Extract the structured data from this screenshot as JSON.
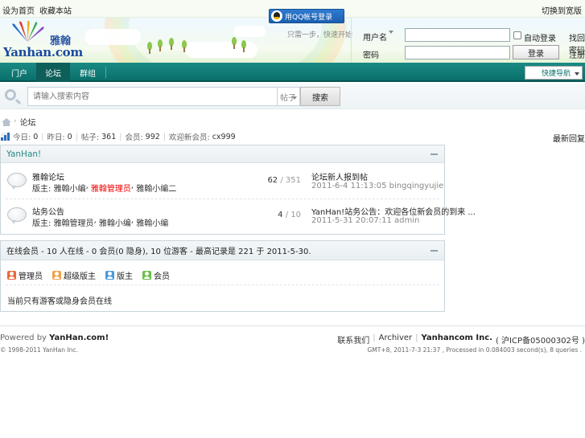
{
  "toplinks": {
    "left": [
      "设为首页",
      "收藏本站"
    ],
    "right": "切换到宽版"
  },
  "header": {
    "logo_text": "Yanhan.com",
    "logo_cn": "雅翰",
    "qq_login": "用QQ帐号登录",
    "qq_sub": "只需一步，快速开始",
    "username_label": "用户名",
    "password_label": "密码",
    "remember_label": "自动登录",
    "forgot_label": "找回密码",
    "login_button": "登录",
    "register_label": "注册"
  },
  "nav": {
    "items": [
      "门户",
      "论坛",
      "群组"
    ],
    "active_index": 1,
    "quick": "快捷导航"
  },
  "search": {
    "placeholder": "请输入搜索内容",
    "type": "帖子",
    "button": "搜索"
  },
  "breadcrumb": {
    "arrow": "›",
    "current": "论坛"
  },
  "stats": {
    "items": [
      {
        "label": "今日:",
        "value": "0"
      },
      {
        "label": "昨日:",
        "value": "0"
      },
      {
        "label": "帖子:",
        "value": "361"
      },
      {
        "label": "会员:",
        "value": "992"
      },
      {
        "label": "欢迎新会员:",
        "value": "cx999"
      }
    ],
    "right": "最新回复"
  },
  "category": {
    "title": "YanHan!",
    "forums": [
      {
        "name": "雅翰论坛",
        "mod_label": "版主:",
        "mods": [
          "雅翰小编",
          "雅翰管理员",
          "雅翰小编二"
        ],
        "threads": "62",
        "posts": "/ 351",
        "last_title": "论坛新人报到帖",
        "last_meta": "2011-6-4 11:13:05 bingqingyujie"
      },
      {
        "name": "站务公告",
        "mod_label": "版主:",
        "mods": [
          "雅翰管理员",
          "雅翰小编",
          "雅翰小编"
        ],
        "threads": "4",
        "posts": "/ 10",
        "last_title": "YanHan!站务公告：欢迎各位新会员的到来 ...",
        "last_meta": "2011-5-31 20:07:11 admin"
      }
    ]
  },
  "online": {
    "title": "在线会员 - 10 人在线 - 0 会员(0 隐身), 10 位游客 - 最高记录是 221 于 2011-5-30.",
    "legend": [
      "管理员",
      "超级版主",
      "版主",
      "会员"
    ],
    "legend_colors": [
      "#e86a3a",
      "#f0a24a",
      "#4a9ad8",
      "#6abf4a"
    ],
    "note": "当前只有游客或隐身会员在线"
  },
  "footer": {
    "powered_label": "Powered by",
    "powered_brand": "YanHan.com!",
    "copyright": "© 1998-2011 YanHan Inc.",
    "links": [
      "联系我们",
      "Archiver"
    ],
    "company": "Yanhancom Inc.",
    "icp": "( 沪ICP备05000302号 )",
    "meta": "GMT+8, 2011-7-3 21:37 , Processed in 0.084003 second(s), 8 queries ."
  }
}
